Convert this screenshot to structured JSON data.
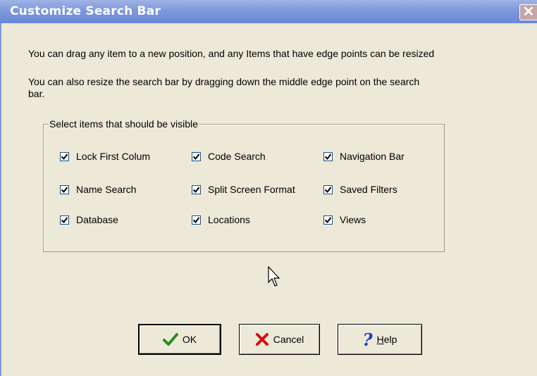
{
  "window": {
    "title": "Customize Search Bar",
    "close_glyph": "✕"
  },
  "info": {
    "line1": "You can drag any item to a new position, and any Items that have edge points can be resized",
    "line2": "You can also resize the search bar by dragging down the middle edge point on the search",
    "line3": "bar."
  },
  "group": {
    "legend": "Select items that should be visible",
    "items": [
      {
        "label": "Lock First Colum",
        "checked": true
      },
      {
        "label": "Code Search",
        "checked": true
      },
      {
        "label": "Navigation Bar",
        "checked": true
      },
      {
        "label": "Name Search",
        "checked": true
      },
      {
        "label": "Split Screen Format",
        "checked": true
      },
      {
        "label": "Saved Filters",
        "checked": true
      },
      {
        "label": "Database",
        "checked": true
      },
      {
        "label": "Locations",
        "checked": true
      },
      {
        "label": "Views",
        "checked": true
      }
    ]
  },
  "buttons": {
    "ok": {
      "label": "OK",
      "icon": "check-icon",
      "color": "#2E8B1F"
    },
    "cancel": {
      "label": "Cancel",
      "icon": "x-icon",
      "color": "#D01010"
    },
    "help": {
      "label_prefix": "",
      "mnemonic": "H",
      "label_rest": "elp",
      "icon": "question-icon",
      "color": "#1E3FC8"
    }
  },
  "colors": {
    "dialog_bg": "#ECE9D8",
    "titlebar": "#7E98DC"
  }
}
